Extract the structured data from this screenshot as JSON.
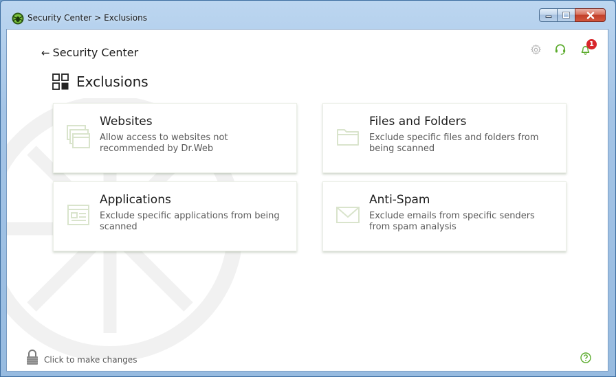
{
  "window": {
    "title": "Security Center > Exclusions",
    "controls": {
      "minimize": "minimize-icon",
      "maximize": "maximize-icon",
      "close": "close-icon"
    }
  },
  "header": {
    "back_label": "Security Center",
    "icons": [
      "gear-icon",
      "headset-icon",
      "bell-icon"
    ],
    "notification_count": "1"
  },
  "page": {
    "title": "Exclusions",
    "title_icon": "grid-icon"
  },
  "cards": [
    {
      "title": "Websites",
      "description": "Allow access to websites not recommended by Dr.Web",
      "icon": "websites-icon"
    },
    {
      "title": "Files and Folders",
      "description": "Exclude specific files and folders from being scanned",
      "icon": "folder-icon"
    },
    {
      "title": "Applications",
      "description": "Exclude specific applications from being scanned",
      "icon": "application-icon"
    },
    {
      "title": "Anti-Spam",
      "description": "Exclude emails from specific senders from spam analysis",
      "icon": "envelope-icon"
    }
  ],
  "footer": {
    "lock_label": "Click to make changes",
    "help_icon": "help-icon"
  },
  "colors": {
    "accent_green": "#5bab2c",
    "badge_red": "#d8262b",
    "icon_pale": "#d9e4cc"
  }
}
